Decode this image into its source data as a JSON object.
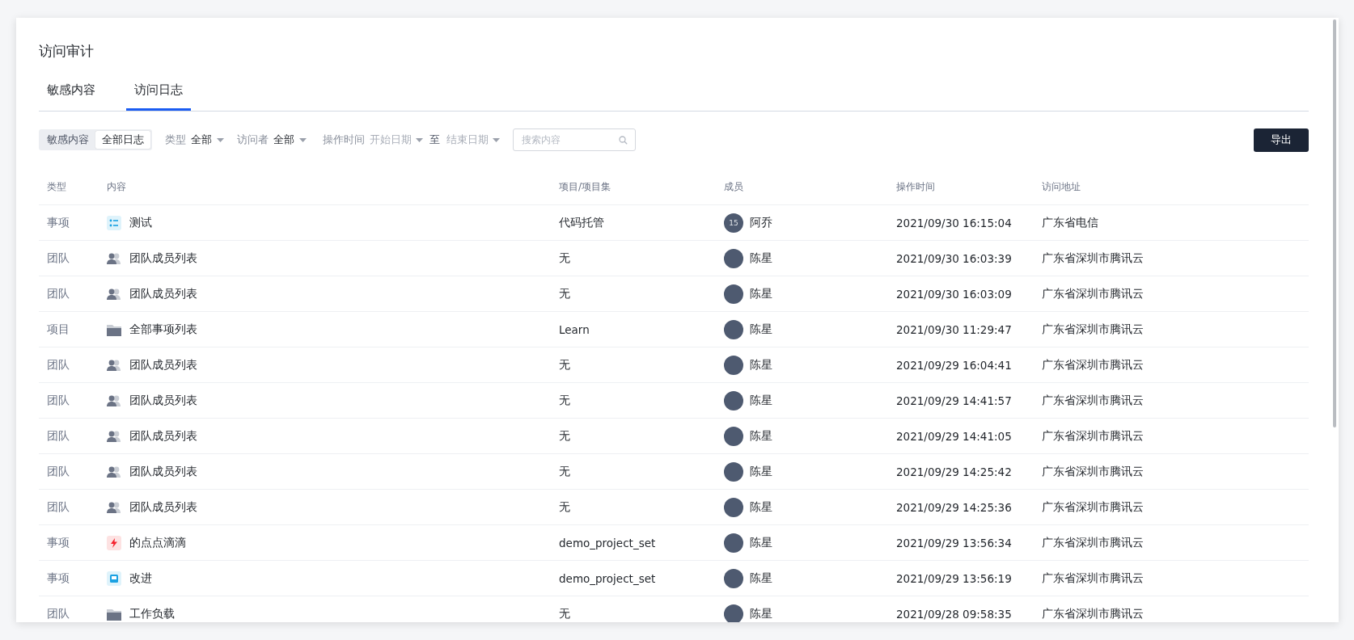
{
  "page": {
    "title": "访问审计"
  },
  "tabs": [
    {
      "label": "敏感内容",
      "selected": false
    },
    {
      "label": "访问日志",
      "selected": true
    }
  ],
  "filters": {
    "segments": [
      {
        "label": "敏感内容",
        "selected": false
      },
      {
        "label": "全部日志",
        "selected": true
      }
    ],
    "type": {
      "label": "类型",
      "value": "全部"
    },
    "visitor": {
      "label": "访问者",
      "value": "全部"
    },
    "time": {
      "label": "操作时间",
      "start_placeholder": "开始日期",
      "separator": "至",
      "end_placeholder": "结束日期"
    },
    "search": {
      "placeholder": "搜索内容"
    },
    "export_button": "导出"
  },
  "table": {
    "columns": [
      "类型",
      "内容",
      "项目/项目集",
      "成员",
      "操作时间",
      "访问地址"
    ],
    "rows": [
      {
        "type": "事项",
        "kind": "list",
        "content": "测试",
        "project": "代码托管",
        "avatar": "15",
        "member": "阿乔",
        "time": "2021/09/30 16:15:04",
        "address": "广东省电信"
      },
      {
        "type": "团队",
        "kind": "team",
        "content": "团队成员列表",
        "project": "无",
        "member": "陈星",
        "time": "2021/09/30 16:03:39",
        "address": "广东省深圳市腾讯云"
      },
      {
        "type": "团队",
        "kind": "team",
        "content": "团队成员列表",
        "project": "无",
        "member": "陈星",
        "time": "2021/09/30 16:03:09",
        "address": "广东省深圳市腾讯云"
      },
      {
        "type": "项目",
        "kind": "folder",
        "content": "全部事项列表",
        "project": "Learn",
        "member": "陈星",
        "time": "2021/09/30 11:29:47",
        "address": "广东省深圳市腾讯云"
      },
      {
        "type": "团队",
        "kind": "team",
        "content": "团队成员列表",
        "project": "无",
        "member": "陈星",
        "time": "2021/09/29 16:04:41",
        "address": "广东省深圳市腾讯云"
      },
      {
        "type": "团队",
        "kind": "team",
        "content": "团队成员列表",
        "project": "无",
        "member": "陈星",
        "time": "2021/09/29 14:41:57",
        "address": "广东省深圳市腾讯云"
      },
      {
        "type": "团队",
        "kind": "team",
        "content": "团队成员列表",
        "project": "无",
        "member": "陈星",
        "time": "2021/09/29 14:41:05",
        "address": "广东省深圳市腾讯云"
      },
      {
        "type": "团队",
        "kind": "team",
        "content": "团队成员列表",
        "project": "无",
        "member": "陈星",
        "time": "2021/09/29 14:25:42",
        "address": "广东省深圳市腾讯云"
      },
      {
        "type": "团队",
        "kind": "team",
        "content": "团队成员列表",
        "project": "无",
        "member": "陈星",
        "time": "2021/09/29 14:25:36",
        "address": "广东省深圳市腾讯云"
      },
      {
        "type": "事项",
        "kind": "bolt",
        "content": "的点点滴滴",
        "project": "demo_project_set",
        "member": "陈星",
        "time": "2021/09/29 13:56:34",
        "address": "广东省深圳市腾讯云"
      },
      {
        "type": "事项",
        "kind": "inbox",
        "content": "改进",
        "project": "demo_project_set",
        "member": "陈星",
        "time": "2021/09/29 13:56:19",
        "address": "广东省深圳市腾讯云"
      },
      {
        "type": "团队",
        "kind": "folder",
        "content": "工作负载",
        "project": "无",
        "member": "陈星",
        "time": "2021/09/28 09:58:35",
        "address": "广东省深圳市腾讯云"
      }
    ]
  }
}
